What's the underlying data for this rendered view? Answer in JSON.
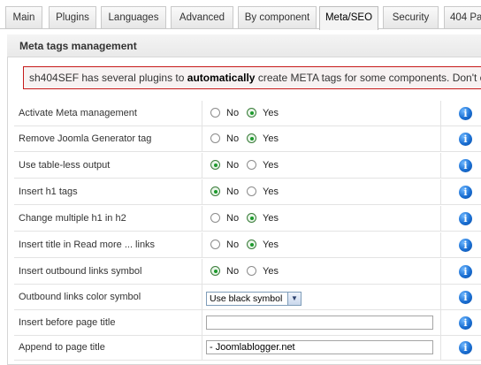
{
  "tabs": [
    {
      "label": "Main",
      "active": false
    },
    {
      "label": "Plugins",
      "active": false
    },
    {
      "label": "Languages",
      "active": false
    },
    {
      "label": "Advanced",
      "active": false
    },
    {
      "label": "By component",
      "active": false
    },
    {
      "label": "Meta/SEO",
      "active": true
    },
    {
      "label": "Security",
      "active": false
    },
    {
      "label": "404 Pa",
      "active": false
    }
  ],
  "section": {
    "title": "Meta tags management"
  },
  "notice": {
    "prefix": "sh404SEF has several plugins to ",
    "bold": "automatically",
    "suffix": " create META tags for some components. Don't create the"
  },
  "options": {
    "no": "No",
    "yes": "Yes"
  },
  "rows": [
    {
      "label": "Activate Meta management",
      "type": "radio",
      "value": "Yes"
    },
    {
      "label": "Remove Joomla Generator tag",
      "type": "radio",
      "value": "Yes"
    },
    {
      "label": "Use table-less output",
      "type": "radio",
      "value": "No"
    },
    {
      "label": "Insert h1 tags",
      "type": "radio",
      "value": "No"
    },
    {
      "label": "Change multiple h1 in h2",
      "type": "radio",
      "value": "Yes"
    },
    {
      "label": "Insert title in Read more ... links",
      "type": "radio",
      "value": "Yes"
    },
    {
      "label": "Insert outbound links symbol",
      "type": "radio",
      "value": "No"
    },
    {
      "label": "Outbound links color symbol",
      "type": "select",
      "value": "Use black symbol"
    },
    {
      "label": "Insert before page title",
      "type": "text",
      "value": ""
    },
    {
      "label": "Append to page title",
      "type": "text",
      "value": "- Joomlablogger.net"
    }
  ],
  "icons": {
    "info": "info-icon",
    "dropdown": "chevron-down-icon"
  },
  "colors": {
    "notice_border": "#c61a1a",
    "info_icon": "#1a6fd3",
    "radio_selected": "#1c9a2c"
  }
}
